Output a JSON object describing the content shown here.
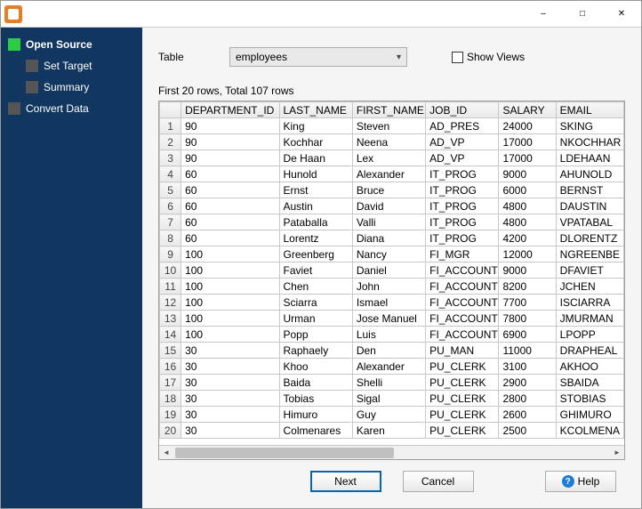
{
  "titlebar": {
    "title": ""
  },
  "sidebar": {
    "steps": [
      {
        "label": "Open Source",
        "active": true,
        "child": false
      },
      {
        "label": "Set Target",
        "active": false,
        "child": true
      },
      {
        "label": "Summary",
        "active": false,
        "child": true
      },
      {
        "label": "Convert Data",
        "active": false,
        "child": false
      }
    ]
  },
  "controls": {
    "table_label": "Table",
    "table_selected": "employees",
    "show_views_label": "Show Views",
    "status_text": "First 20 rows, Total 107 rows"
  },
  "columns": [
    "DEPARTMENT_ID",
    "LAST_NAME",
    "FIRST_NAME",
    "JOB_ID",
    "SALARY",
    "EMAIL"
  ],
  "rows": [
    [
      "90",
      "King",
      "Steven",
      "AD_PRES",
      "24000",
      "SKING"
    ],
    [
      "90",
      "Kochhar",
      "Neena",
      "AD_VP",
      "17000",
      "NKOCHHAR"
    ],
    [
      "90",
      "De Haan",
      "Lex",
      "AD_VP",
      "17000",
      "LDEHAAN"
    ],
    [
      "60",
      "Hunold",
      "Alexander",
      "IT_PROG",
      "9000",
      "AHUNOLD"
    ],
    [
      "60",
      "Ernst",
      "Bruce",
      "IT_PROG",
      "6000",
      "BERNST"
    ],
    [
      "60",
      "Austin",
      "David",
      "IT_PROG",
      "4800",
      "DAUSTIN"
    ],
    [
      "60",
      "Pataballa",
      "Valli",
      "IT_PROG",
      "4800",
      "VPATABAL"
    ],
    [
      "60",
      "Lorentz",
      "Diana",
      "IT_PROG",
      "4200",
      "DLORENTZ"
    ],
    [
      "100",
      "Greenberg",
      "Nancy",
      "FI_MGR",
      "12000",
      "NGREENBE"
    ],
    [
      "100",
      "Faviet",
      "Daniel",
      "FI_ACCOUNT",
      "9000",
      "DFAVIET"
    ],
    [
      "100",
      "Chen",
      "John",
      "FI_ACCOUNT",
      "8200",
      "JCHEN"
    ],
    [
      "100",
      "Sciarra",
      "Ismael",
      "FI_ACCOUNT",
      "7700",
      "ISCIARRA"
    ],
    [
      "100",
      "Urman",
      "Jose Manuel",
      "FI_ACCOUNT",
      "7800",
      "JMURMAN"
    ],
    [
      "100",
      "Popp",
      "Luis",
      "FI_ACCOUNT",
      "6900",
      "LPOPP"
    ],
    [
      "30",
      "Raphaely",
      "Den",
      "PU_MAN",
      "11000",
      "DRAPHEAL"
    ],
    [
      "30",
      "Khoo",
      "Alexander",
      "PU_CLERK",
      "3100",
      "AKHOO"
    ],
    [
      "30",
      "Baida",
      "Shelli",
      "PU_CLERK",
      "2900",
      "SBAIDA"
    ],
    [
      "30",
      "Tobias",
      "Sigal",
      "PU_CLERK",
      "2800",
      "STOBIAS"
    ],
    [
      "30",
      "Himuro",
      "Guy",
      "PU_CLERK",
      "2600",
      "GHIMURO"
    ],
    [
      "30",
      "Colmenares",
      "Karen",
      "PU_CLERK",
      "2500",
      "KCOLMENA"
    ]
  ],
  "buttons": {
    "next": "Next",
    "cancel": "Cancel",
    "help": "Help"
  }
}
